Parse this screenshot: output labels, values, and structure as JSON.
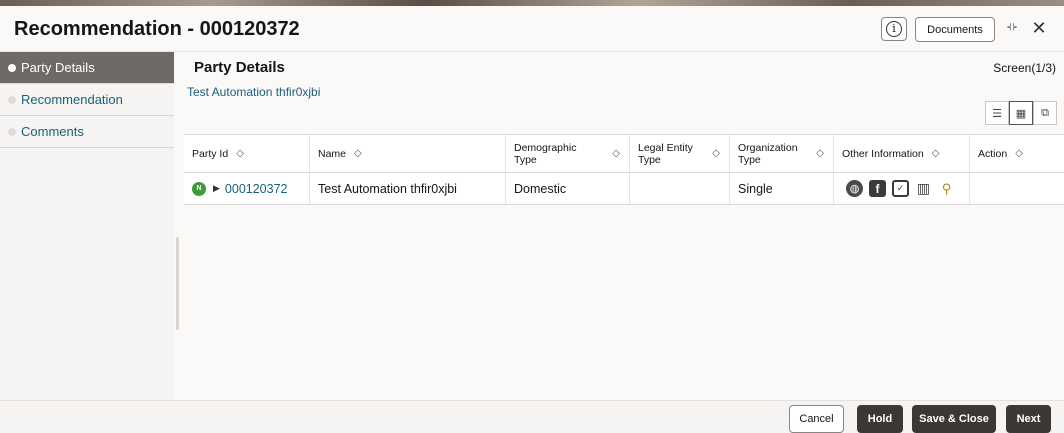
{
  "header": {
    "title": "Recommendation - 000120372",
    "info_icon": "i",
    "documents_label": "Documents",
    "minimize_icon": "collapse-icon",
    "close_icon": "close-icon"
  },
  "sidebar": {
    "items": [
      {
        "label": "Party Details",
        "active": true
      },
      {
        "label": "Recommendation",
        "active": false
      },
      {
        "label": "Comments",
        "active": false
      }
    ]
  },
  "main": {
    "section_title": "Party Details",
    "screen_count": "Screen(1/3)",
    "party_name_link": "Test Automation thfir0xjbi",
    "view_icons": [
      "list-view-icon",
      "grid-view-icon",
      "tree-view-icon"
    ]
  },
  "table": {
    "headers": [
      "Party Id",
      "Name",
      "Demographic Type",
      "Legal Entity Type",
      "Organization Type",
      "Other Information",
      "Action"
    ],
    "rows": [
      {
        "badge": "N",
        "party_id": "000120372",
        "name": "Test Automation thfir0xjbi",
        "demographic_type": "Domestic",
        "legal_entity_type": "",
        "organization_type": "Single",
        "other_information_icons": [
          "globe-icon",
          "facebook-icon",
          "twitter-icon",
          "building-icon",
          "map-pin-icon"
        ],
        "action": ""
      }
    ]
  },
  "footer": {
    "cancel": "Cancel",
    "hold": "Hold",
    "save_close": "Save & Close",
    "next": "Next"
  },
  "colors": {
    "link": "#1b5f7a",
    "active_sidebar": "#6e6a66",
    "primary_button": "#3b3835",
    "badge_green": "#3d9a3d"
  }
}
